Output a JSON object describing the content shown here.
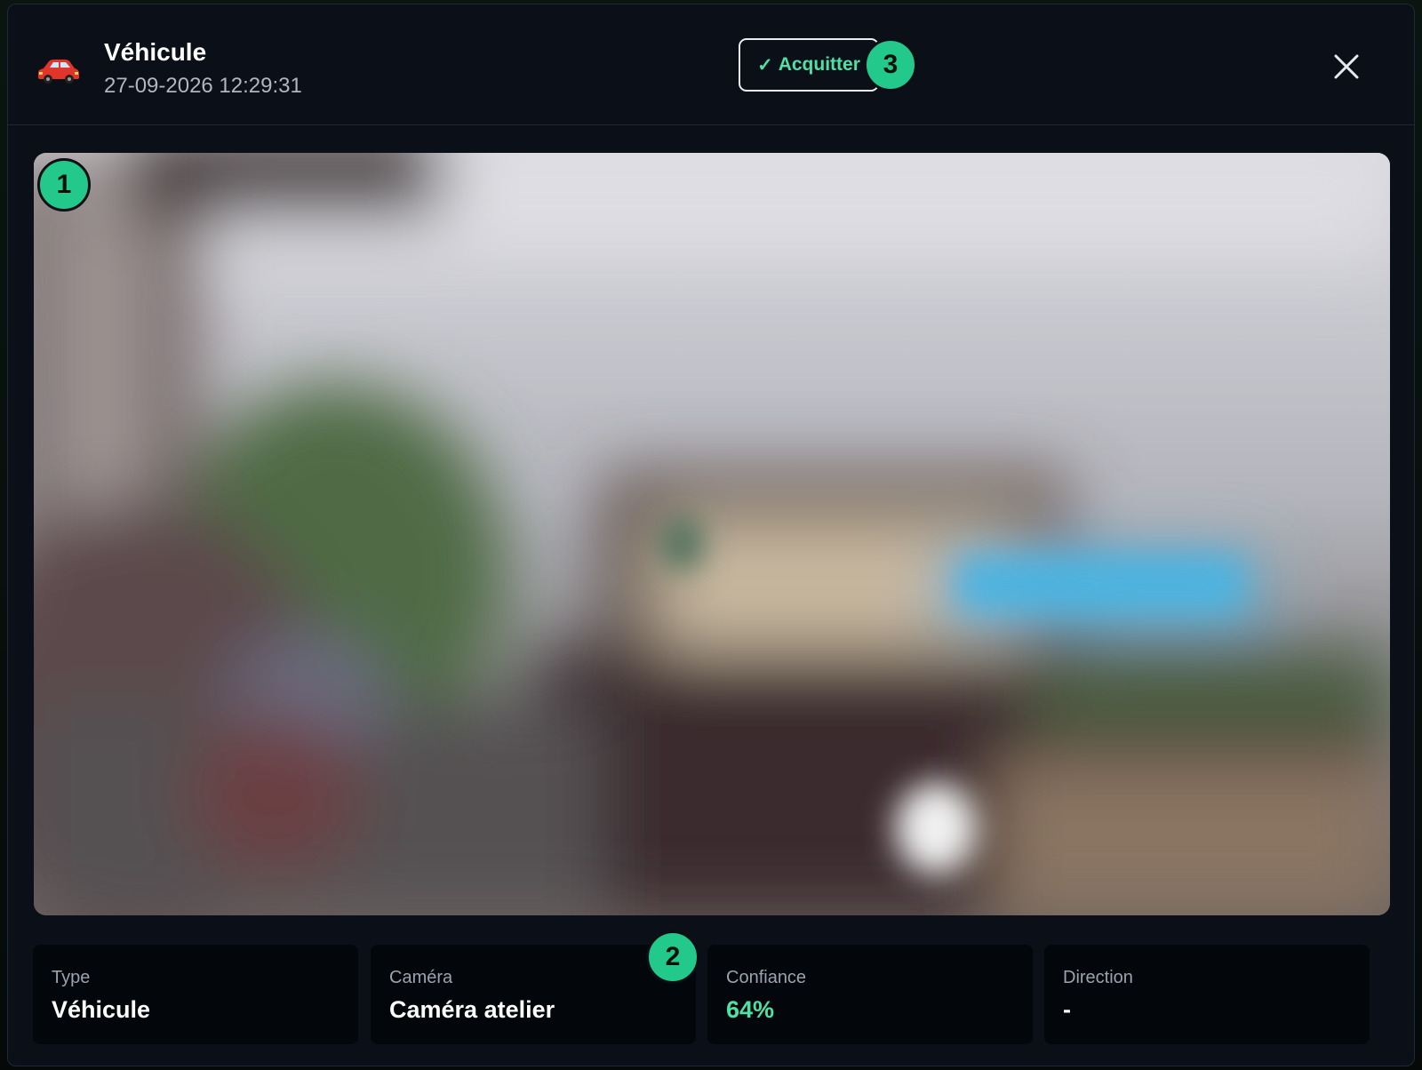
{
  "header": {
    "icon": "car-icon",
    "title": "Véhicule",
    "timestamp": "27-09-2026 12:29:31",
    "ack_check": "✓",
    "ack_label": "Acquitter",
    "close_icon": "close-icon"
  },
  "badges": {
    "image": "1",
    "details": "2",
    "acknowledge": "3"
  },
  "details": [
    {
      "label": "Type",
      "value": "Véhicule"
    },
    {
      "label": "Caméra",
      "value": "Caméra atelier"
    },
    {
      "label": "Confiance",
      "value": "64%"
    },
    {
      "label": "Direction",
      "value": "-"
    }
  ],
  "colors": {
    "accent": "#22c98a",
    "ack_text": "#4fe0a6",
    "confidence": "#4fe0a6",
    "modal_bg": "#0b1018",
    "card_bg": "#03070c"
  }
}
